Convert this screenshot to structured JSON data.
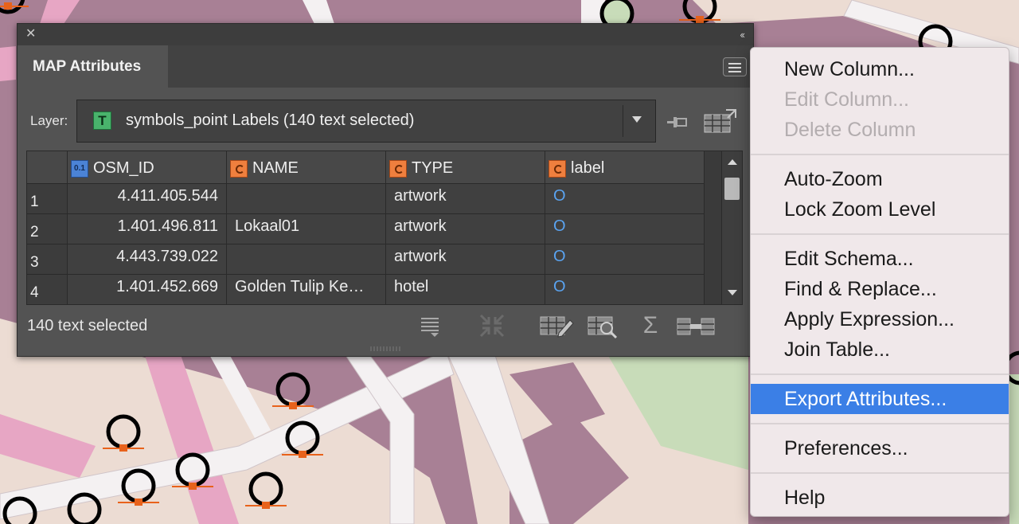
{
  "panel": {
    "close_glyph": "✕",
    "collapse_glyph": "‹‹",
    "tab_label": "MAP Attributes",
    "layer_label": "Layer:",
    "layer_type_glyph": "T",
    "layer_value": "symbols_point Labels (140 text selected)",
    "columns": [
      {
        "name": "OSM_ID",
        "type": "number",
        "type_glyph": "0.1"
      },
      {
        "name": "NAME",
        "type": "string"
      },
      {
        "name": "TYPE",
        "type": "string"
      },
      {
        "name": "label",
        "type": "string"
      }
    ],
    "rows": [
      {
        "index": "1",
        "osm_id": "4.411.405.544",
        "name": "",
        "type": "artwork",
        "label": "O"
      },
      {
        "index": "2",
        "osm_id": "1.401.496.811",
        "name": "Lokaal01",
        "type": "artwork",
        "label": "O"
      },
      {
        "index": "3",
        "osm_id": "4.443.739.022",
        "name": "",
        "type": "artwork",
        "label": "O"
      },
      {
        "index": "4",
        "osm_id": "1.401.452.669",
        "name": "Golden Tulip Ke…",
        "type": "hotel",
        "label": "O"
      }
    ],
    "status": "140 text selected",
    "toolbar_icons": [
      "list-icon",
      "collapse-arrows-icon",
      "edit-table-icon",
      "table-search-icon",
      "sigma-icon",
      "join-table-icon"
    ],
    "sigma_glyph": "Σ"
  },
  "context_menu": {
    "items": [
      {
        "label": "New Column...",
        "enabled": true
      },
      {
        "label": "Edit Column...",
        "enabled": false
      },
      {
        "label": "Delete Column",
        "enabled": false
      },
      {
        "label": "Auto-Zoom",
        "enabled": true
      },
      {
        "label": "Lock Zoom Level",
        "enabled": true
      },
      {
        "label": "Edit Schema...",
        "enabled": true
      },
      {
        "label": "Find & Replace...",
        "enabled": true
      },
      {
        "label": "Apply Expression...",
        "enabled": true
      },
      {
        "label": "Join Table...",
        "enabled": true
      },
      {
        "label": "Export Attributes...",
        "enabled": true,
        "highlighted": true
      },
      {
        "label": "Preferences...",
        "enabled": true
      },
      {
        "label": "Help",
        "enabled": true
      }
    ]
  },
  "colors": {
    "panel_bg": "#535353",
    "menu_bg": "#f0e8ea",
    "menu_highlight": "#3b7fe6",
    "label_value_color": "#5aa3f0",
    "map_buildings": "#a88095",
    "map_roads": "#f2f2f2",
    "map_green": "#c8dcb9",
    "symbol_marker": "#e8621b"
  }
}
